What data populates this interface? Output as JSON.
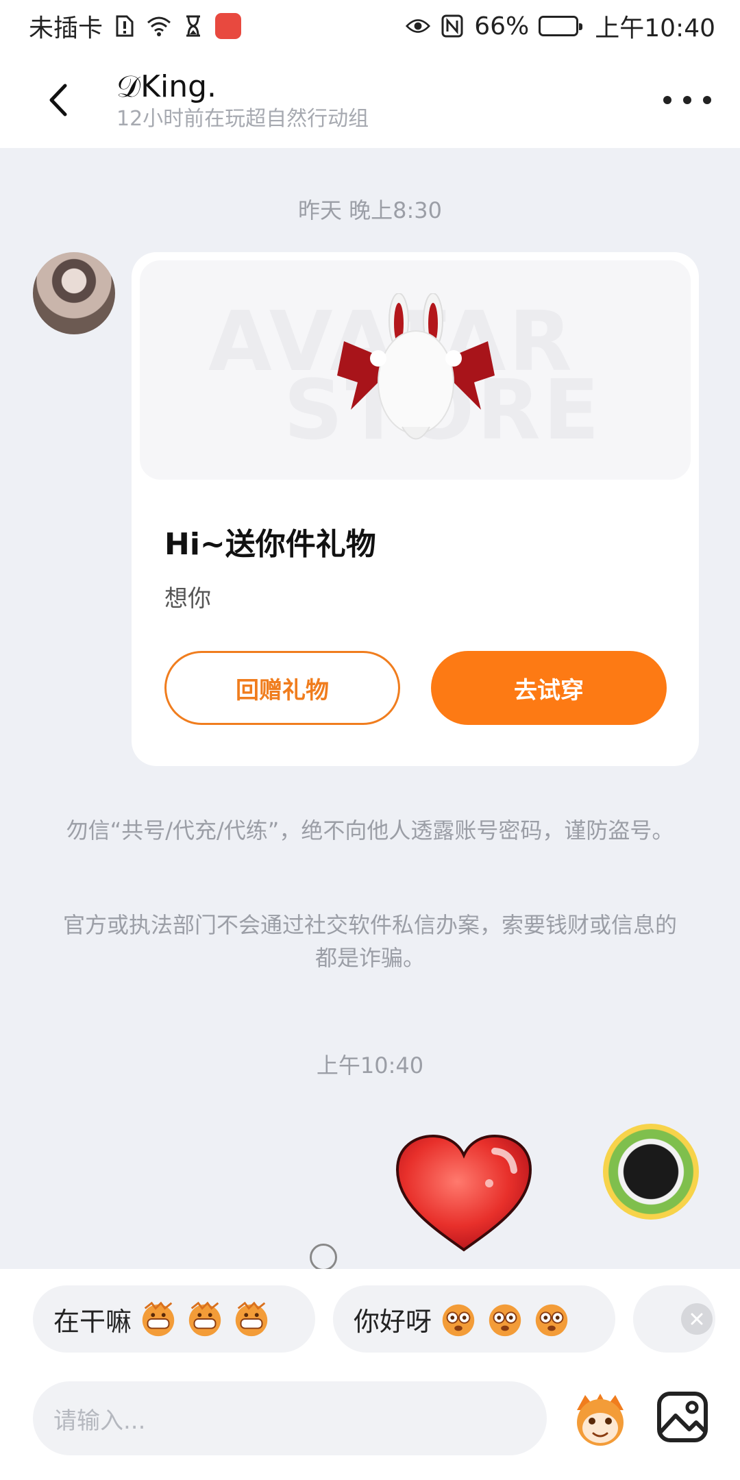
{
  "status_bar": {
    "carrier": "未插卡",
    "battery": "66%",
    "battery_level": 0.66,
    "time": "上午10:40"
  },
  "header": {
    "name": "𝒟King.",
    "status": "12小时前在玩超自然行动组"
  },
  "chat": {
    "timestamp_1": "昨天 晚上8:30",
    "gift_card": {
      "watermark_line1": "AVATAR",
      "watermark_line2": "STORE",
      "title": "Hi~送你件礼物",
      "message": "想你",
      "return_gift_label": "回赠礼物",
      "try_on_label": "去试穿"
    },
    "notice_1": "勿信“共号/代充/代练”，绝不向他人透露账号密码，谨防盗号。",
    "notice_2": "官方或执法部门不会通过社交软件私信办案，索要钱财或信息的都是诈骗。",
    "timestamp_2": "上午10:40"
  },
  "quick_replies": [
    {
      "text": "在干嘛"
    },
    {
      "text": "你好呀"
    }
  ],
  "input": {
    "placeholder": "请输入..."
  },
  "colors": {
    "accent": "#fd7a14",
    "background": "#eef0f5"
  }
}
